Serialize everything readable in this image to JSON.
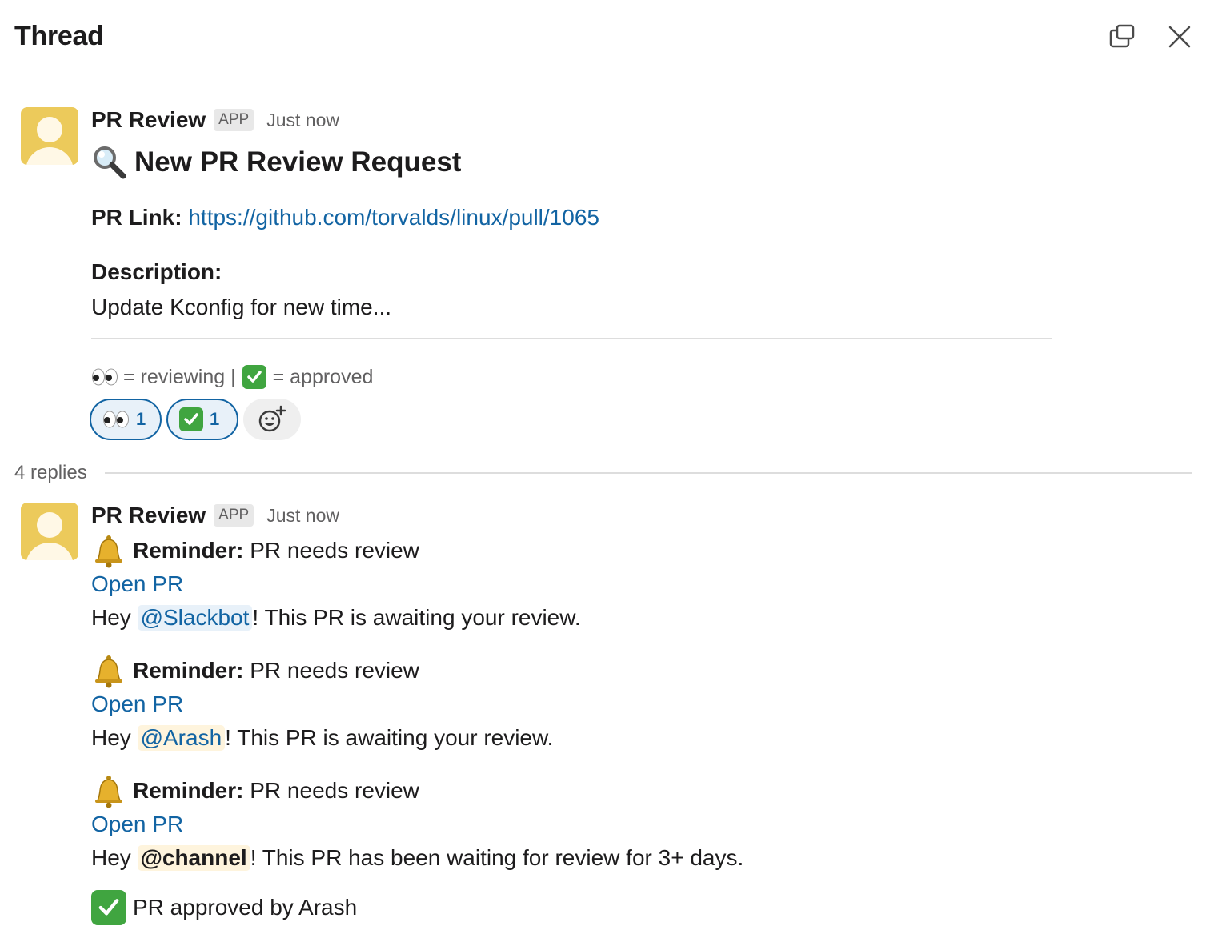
{
  "header": {
    "title": "Thread"
  },
  "parent": {
    "sender": "PR Review",
    "badge": "APP",
    "time": "Just now",
    "title": "New PR Review Request",
    "pr_link_label": "PR Link:",
    "pr_link_url": "https://github.com/torvalds/linux/pull/1065",
    "description_label": "Description:",
    "description": "Update Kconfig for new time...",
    "legend_reviewing": "= reviewing |",
    "legend_approved": "= approved",
    "reactions": [
      {
        "emoji": "eyes",
        "count": "1"
      },
      {
        "emoji": "white_check_mark",
        "count": "1"
      }
    ]
  },
  "replies_count": "4 replies",
  "reply": {
    "sender": "PR Review",
    "badge": "APP",
    "time": "Just now",
    "reminder_label": "Reminder:",
    "reminder_text": "PR needs review",
    "open_pr": "Open PR",
    "hey": "Hey",
    "mention_1": "@Slackbot",
    "text_1": "! This PR is awaiting your review.",
    "mention_2": "@Arash",
    "text_2": "! This PR is awaiting your review.",
    "mention_3": "@channel",
    "text_3": "! This PR has been waiting for review for 3+ days.",
    "approved_text": "PR approved by Arash"
  },
  "colors": {
    "link": "#1264a3",
    "avatar": "#ecca5b",
    "check": "#40a540"
  }
}
